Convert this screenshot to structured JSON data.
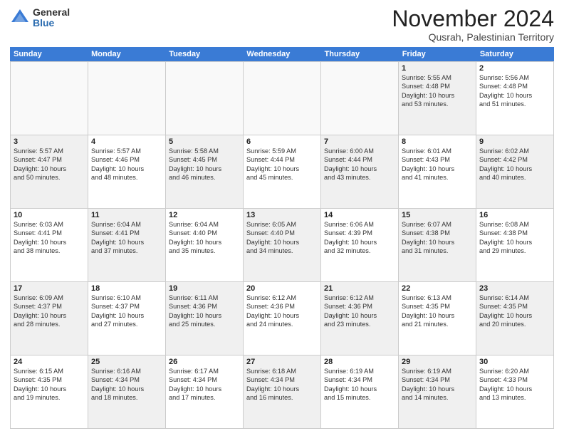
{
  "logo": {
    "general": "General",
    "blue": "Blue"
  },
  "title": "November 2024",
  "location": "Qusrah, Palestinian Territory",
  "days_header": [
    "Sunday",
    "Monday",
    "Tuesday",
    "Wednesday",
    "Thursday",
    "Friday",
    "Saturday"
  ],
  "weeks": [
    [
      {
        "day": "",
        "info": "",
        "empty": true
      },
      {
        "day": "",
        "info": "",
        "empty": true
      },
      {
        "day": "",
        "info": "",
        "empty": true
      },
      {
        "day": "",
        "info": "",
        "empty": true
      },
      {
        "day": "",
        "info": "",
        "empty": true
      },
      {
        "day": "1",
        "info": "Sunrise: 5:55 AM\nSunset: 4:48 PM\nDaylight: 10 hours\nand 53 minutes.",
        "shaded": true
      },
      {
        "day": "2",
        "info": "Sunrise: 5:56 AM\nSunset: 4:48 PM\nDaylight: 10 hours\nand 51 minutes.",
        "shaded": false
      }
    ],
    [
      {
        "day": "3",
        "info": "Sunrise: 5:57 AM\nSunset: 4:47 PM\nDaylight: 10 hours\nand 50 minutes.",
        "shaded": true
      },
      {
        "day": "4",
        "info": "Sunrise: 5:57 AM\nSunset: 4:46 PM\nDaylight: 10 hours\nand 48 minutes.",
        "shaded": false
      },
      {
        "day": "5",
        "info": "Sunrise: 5:58 AM\nSunset: 4:45 PM\nDaylight: 10 hours\nand 46 minutes.",
        "shaded": true
      },
      {
        "day": "6",
        "info": "Sunrise: 5:59 AM\nSunset: 4:44 PM\nDaylight: 10 hours\nand 45 minutes.",
        "shaded": false
      },
      {
        "day": "7",
        "info": "Sunrise: 6:00 AM\nSunset: 4:44 PM\nDaylight: 10 hours\nand 43 minutes.",
        "shaded": true
      },
      {
        "day": "8",
        "info": "Sunrise: 6:01 AM\nSunset: 4:43 PM\nDaylight: 10 hours\nand 41 minutes.",
        "shaded": false
      },
      {
        "day": "9",
        "info": "Sunrise: 6:02 AM\nSunset: 4:42 PM\nDaylight: 10 hours\nand 40 minutes.",
        "shaded": true
      }
    ],
    [
      {
        "day": "10",
        "info": "Sunrise: 6:03 AM\nSunset: 4:41 PM\nDaylight: 10 hours\nand 38 minutes.",
        "shaded": false
      },
      {
        "day": "11",
        "info": "Sunrise: 6:04 AM\nSunset: 4:41 PM\nDaylight: 10 hours\nand 37 minutes.",
        "shaded": true
      },
      {
        "day": "12",
        "info": "Sunrise: 6:04 AM\nSunset: 4:40 PM\nDaylight: 10 hours\nand 35 minutes.",
        "shaded": false
      },
      {
        "day": "13",
        "info": "Sunrise: 6:05 AM\nSunset: 4:40 PM\nDaylight: 10 hours\nand 34 minutes.",
        "shaded": true
      },
      {
        "day": "14",
        "info": "Sunrise: 6:06 AM\nSunset: 4:39 PM\nDaylight: 10 hours\nand 32 minutes.",
        "shaded": false
      },
      {
        "day": "15",
        "info": "Sunrise: 6:07 AM\nSunset: 4:38 PM\nDaylight: 10 hours\nand 31 minutes.",
        "shaded": true
      },
      {
        "day": "16",
        "info": "Sunrise: 6:08 AM\nSunset: 4:38 PM\nDaylight: 10 hours\nand 29 minutes.",
        "shaded": false
      }
    ],
    [
      {
        "day": "17",
        "info": "Sunrise: 6:09 AM\nSunset: 4:37 PM\nDaylight: 10 hours\nand 28 minutes.",
        "shaded": true
      },
      {
        "day": "18",
        "info": "Sunrise: 6:10 AM\nSunset: 4:37 PM\nDaylight: 10 hours\nand 27 minutes.",
        "shaded": false
      },
      {
        "day": "19",
        "info": "Sunrise: 6:11 AM\nSunset: 4:36 PM\nDaylight: 10 hours\nand 25 minutes.",
        "shaded": true
      },
      {
        "day": "20",
        "info": "Sunrise: 6:12 AM\nSunset: 4:36 PM\nDaylight: 10 hours\nand 24 minutes.",
        "shaded": false
      },
      {
        "day": "21",
        "info": "Sunrise: 6:12 AM\nSunset: 4:36 PM\nDaylight: 10 hours\nand 23 minutes.",
        "shaded": true
      },
      {
        "day": "22",
        "info": "Sunrise: 6:13 AM\nSunset: 4:35 PM\nDaylight: 10 hours\nand 21 minutes.",
        "shaded": false
      },
      {
        "day": "23",
        "info": "Sunrise: 6:14 AM\nSunset: 4:35 PM\nDaylight: 10 hours\nand 20 minutes.",
        "shaded": true
      }
    ],
    [
      {
        "day": "24",
        "info": "Sunrise: 6:15 AM\nSunset: 4:35 PM\nDaylight: 10 hours\nand 19 minutes.",
        "shaded": false
      },
      {
        "day": "25",
        "info": "Sunrise: 6:16 AM\nSunset: 4:34 PM\nDaylight: 10 hours\nand 18 minutes.",
        "shaded": true
      },
      {
        "day": "26",
        "info": "Sunrise: 6:17 AM\nSunset: 4:34 PM\nDaylight: 10 hours\nand 17 minutes.",
        "shaded": false
      },
      {
        "day": "27",
        "info": "Sunrise: 6:18 AM\nSunset: 4:34 PM\nDaylight: 10 hours\nand 16 minutes.",
        "shaded": true
      },
      {
        "day": "28",
        "info": "Sunrise: 6:19 AM\nSunset: 4:34 PM\nDaylight: 10 hours\nand 15 minutes.",
        "shaded": false
      },
      {
        "day": "29",
        "info": "Sunrise: 6:19 AM\nSunset: 4:34 PM\nDaylight: 10 hours\nand 14 minutes.",
        "shaded": true
      },
      {
        "day": "30",
        "info": "Sunrise: 6:20 AM\nSunset: 4:33 PM\nDaylight: 10 hours\nand 13 minutes.",
        "shaded": false
      }
    ]
  ]
}
